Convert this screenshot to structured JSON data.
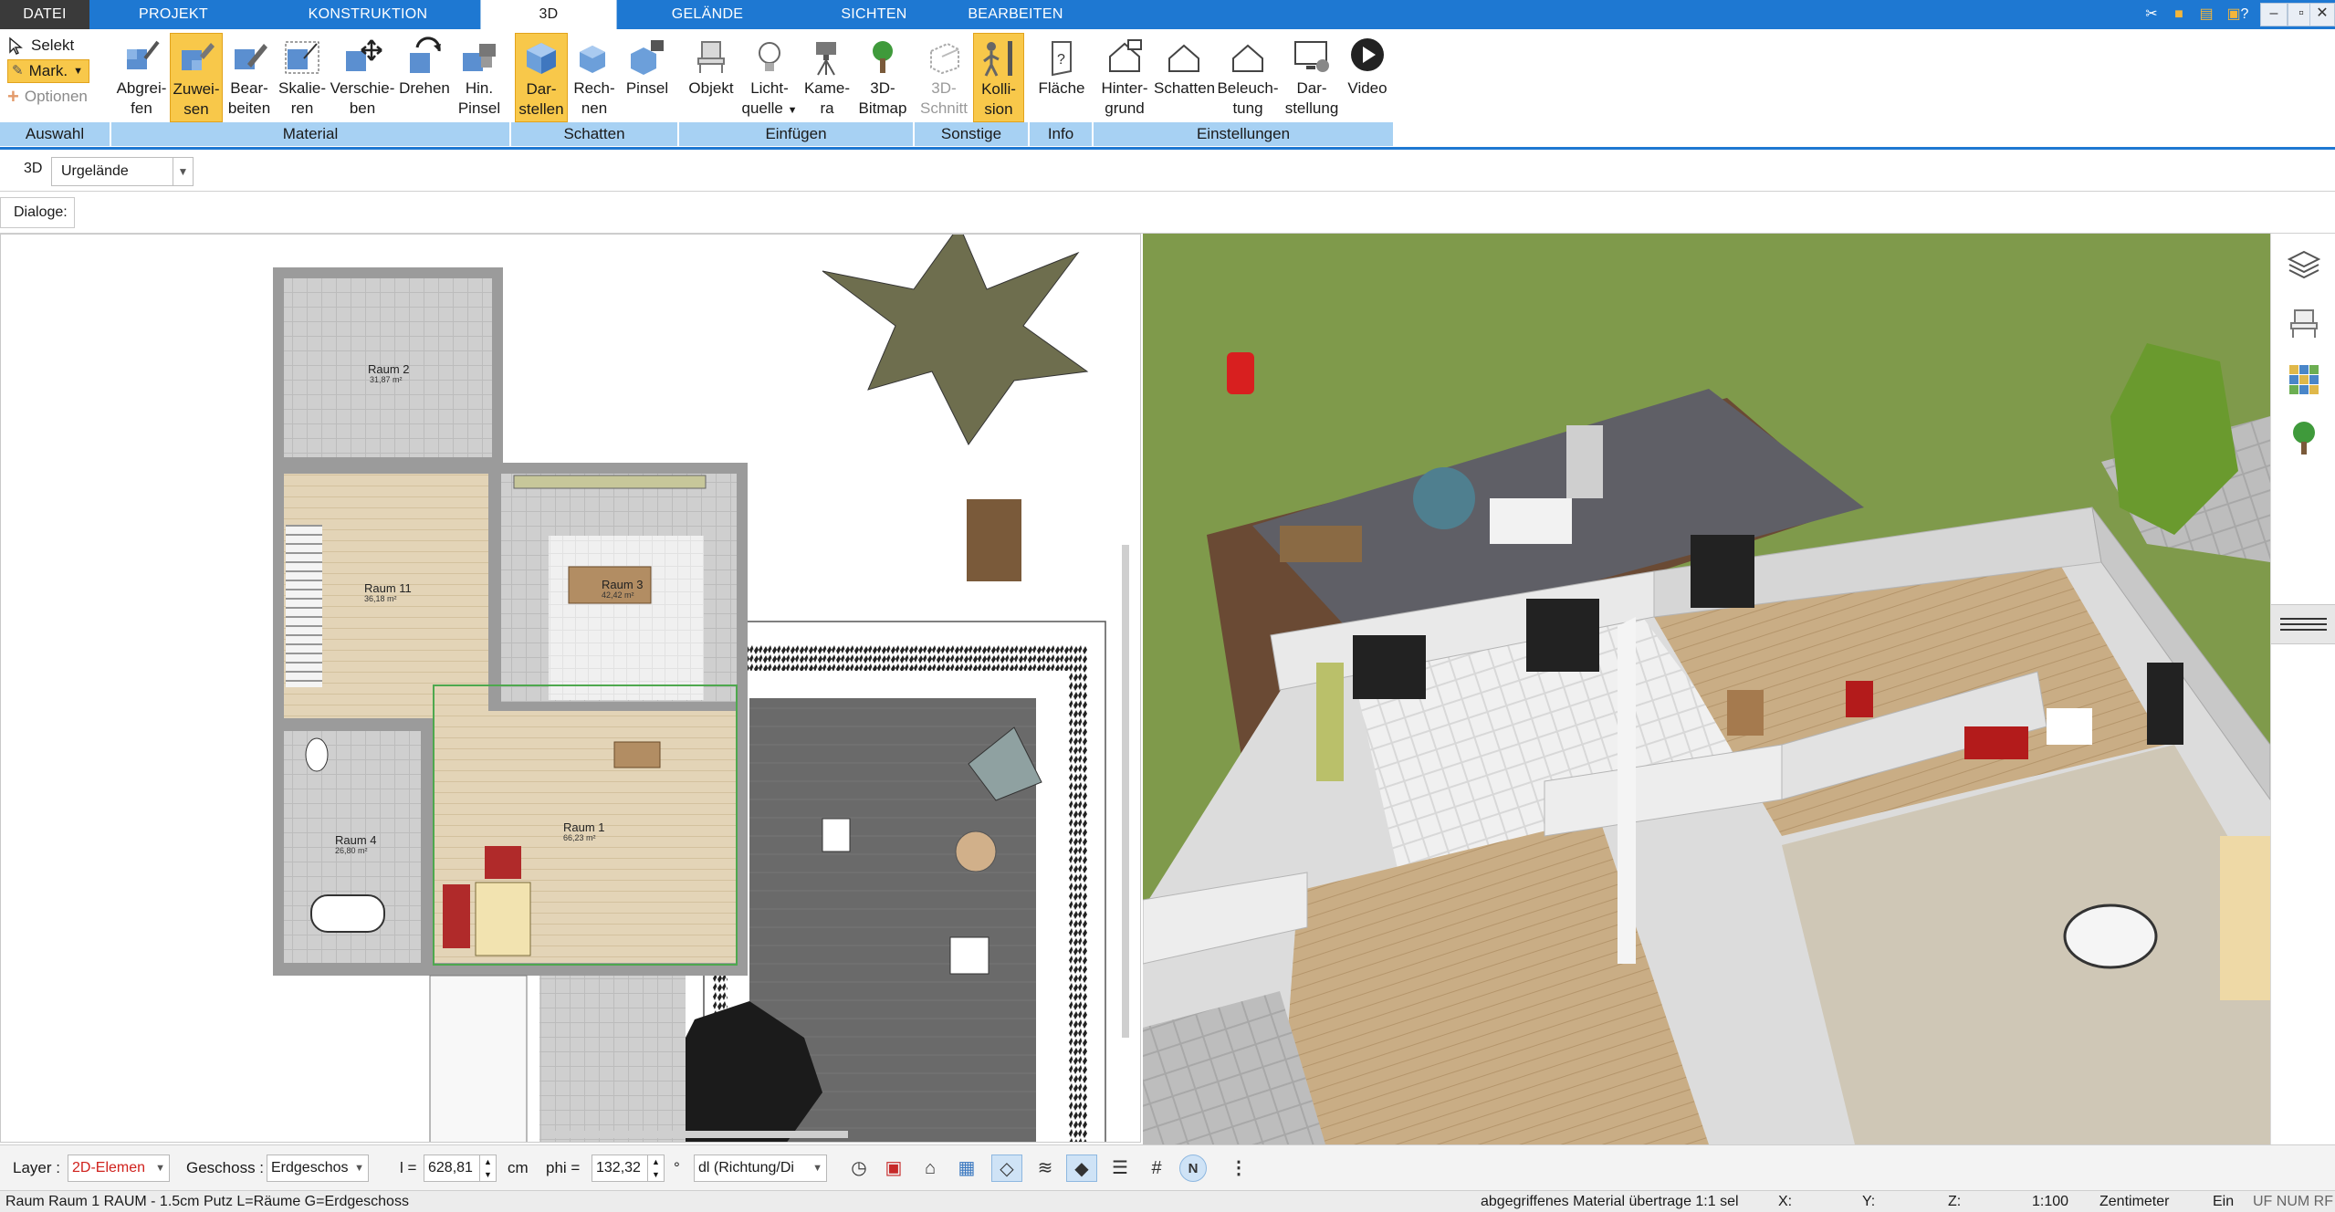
{
  "menu": {
    "tabs": [
      "DATEI",
      "PROJEKT",
      "KONSTRUKTION",
      "3D",
      "GELÄNDE",
      "SICHTEN",
      "BEARBEITEN"
    ],
    "active": "3D"
  },
  "selection_group": {
    "selekt": "Selekt",
    "mark": "Mark.",
    "optionen": "Optionen",
    "group_label": "Auswahl"
  },
  "ribbon": {
    "material": {
      "label": "Material",
      "buttons": [
        {
          "line1": "Abgrei-",
          "line2": "fen"
        },
        {
          "line1": "Zuwei-",
          "line2": "sen"
        },
        {
          "line1": "Bear-",
          "line2": "beiten"
        },
        {
          "line1": "Skalie-",
          "line2": "ren"
        },
        {
          "line1": "Verschie-",
          "line2": "ben"
        },
        {
          "line1": "Drehen",
          "line2": ""
        },
        {
          "line1": "Hin.",
          "line2": "Pinsel"
        }
      ]
    },
    "schatten": {
      "label": "Schatten",
      "buttons": [
        {
          "line1": "Dar-",
          "line2": "stellen"
        },
        {
          "line1": "Rech-",
          "line2": "nen"
        },
        {
          "line1": "Pinsel",
          "line2": ""
        }
      ]
    },
    "einfuegen": {
      "label": "Einfügen",
      "buttons": [
        {
          "line1": "Objekt",
          "line2": ""
        },
        {
          "line1": "Licht-",
          "line2": "quelle"
        },
        {
          "line1": "Kame-",
          "line2": "ra"
        },
        {
          "line1": "3D-",
          "line2": "Bitmap"
        }
      ]
    },
    "sonstige": {
      "label": "Sonstige",
      "buttons": [
        {
          "line1": "3D-",
          "line2": "Schnitt"
        },
        {
          "line1": "Kolli-",
          "line2": "sion"
        }
      ]
    },
    "info": {
      "label": "Info",
      "buttons": [
        {
          "line1": "Fläche",
          "line2": ""
        }
      ]
    },
    "einstellungen": {
      "label": "Einstellungen",
      "buttons": [
        {
          "line1": "Hinter-",
          "line2": "grund"
        },
        {
          "line1": "Schatten",
          "line2": ""
        },
        {
          "line1": "Beleuch-",
          "line2": "tung"
        },
        {
          "line1": "Dar-",
          "line2": "stellung"
        },
        {
          "line1": "Video",
          "line2": ""
        }
      ]
    }
  },
  "subtoolbar": {
    "mode_label": "3D",
    "terrain_value": "Urgelände",
    "dialoge_label": "Dialoge:"
  },
  "plan": {
    "rooms": [
      {
        "name": "Raum 2",
        "area": "31,87 m²"
      },
      {
        "name": "Raum 11",
        "area": "36,18 m²"
      },
      {
        "name": "Raum 3",
        "area": "42,42 m²"
      },
      {
        "name": "Raum 1",
        "area": "66,23 m²"
      },
      {
        "name": "Raum 4",
        "area": "26,80 m²"
      }
    ]
  },
  "bottombar": {
    "layer_label": "Layer :",
    "layer_value": "2D-Elemen",
    "geschoss_label": "Geschoss :",
    "geschoss_value": "Erdgeschos",
    "l_label": "l =",
    "l_value": "628,81",
    "l_unit": "cm",
    "phi_label": "phi =",
    "phi_value": "132,32",
    "phi_unit": "°",
    "mode_value": "dl (Richtung/Di"
  },
  "statusbar": {
    "info": "Raum Raum 1 RAUM - 1.5cm Putz L=Räume G=Erdgeschoss",
    "message": "abgegriffenes Material übertrage 1:1 sel",
    "x_label": "X:",
    "y_label": "Y:",
    "z_label": "Z:",
    "scale": "1:100",
    "unit": "Zentimeter",
    "ein": "Ein",
    "flags": "UF NUM RF"
  },
  "colors": {
    "accent": "#1e78d2",
    "group_strip": "#a7d1f3",
    "selected_button": "#f8c84a",
    "lawn": "#7f9a4b",
    "deck": "#5f5f66"
  }
}
